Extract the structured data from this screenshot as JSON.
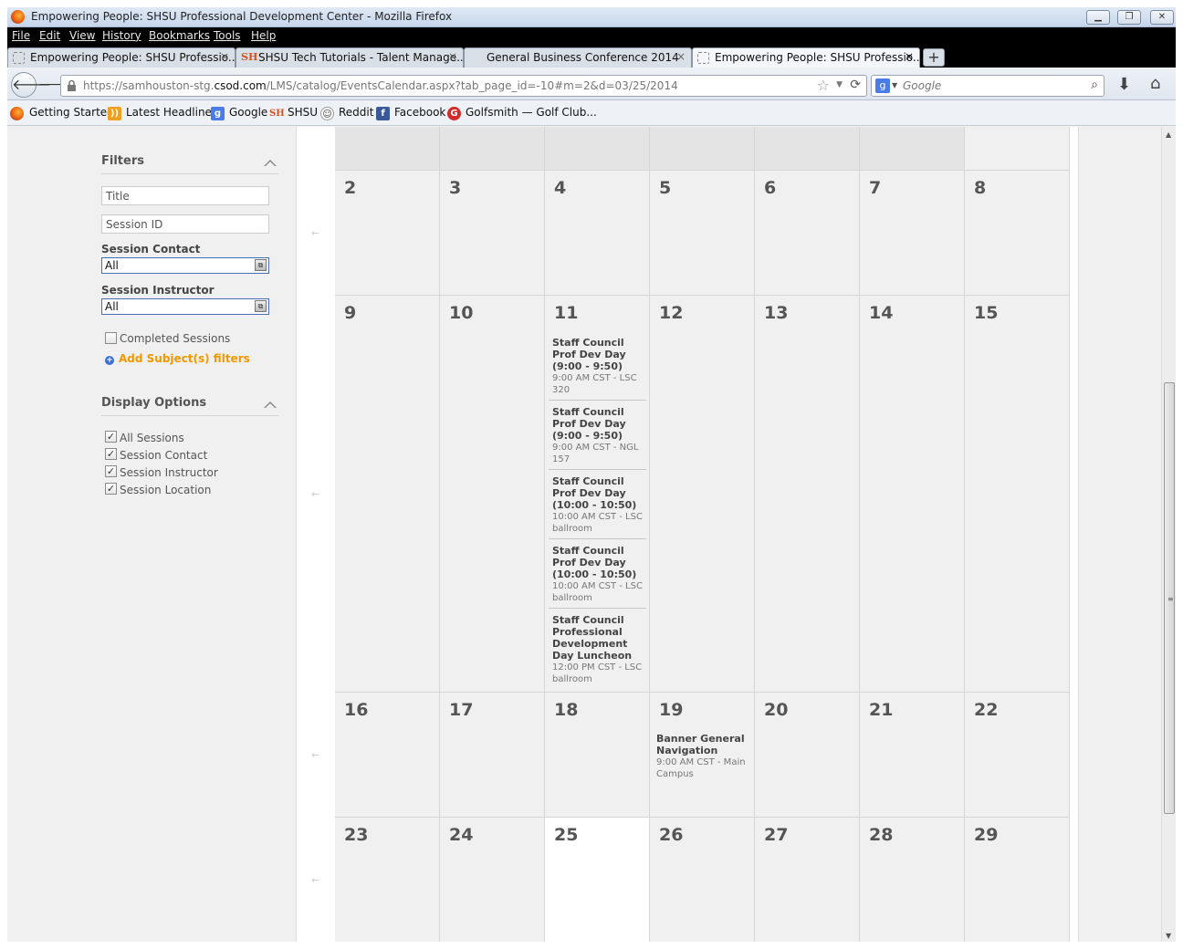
{
  "window": {
    "title": "Empowering People: SHSU Professional Development Center - Mozilla Firefox"
  },
  "menu": [
    "File",
    "Edit",
    "View",
    "History",
    "Bookmarks",
    "Tools",
    "Help"
  ],
  "tabs": [
    {
      "label": "Empowering People: SHSU Professio...",
      "icon": "blank-page-icon",
      "close": "×"
    },
    {
      "label": "SHSU Tech Tutorials - Talent Manage...",
      "icon": "shsu-icon",
      "close": "×"
    },
    {
      "label": "General Business Conference 2014",
      "icon": "none",
      "close": "×"
    },
    {
      "label": "Empowering People: SHSU Professio...",
      "icon": "blank-page-icon",
      "close": "×",
      "active": true
    }
  ],
  "newtab": "+",
  "nav": {
    "url_prefix": "https://samhouston-stg.",
    "url_domain": "csod.com",
    "url_suffix": "/LMS/catalog/EventsCalendar.aspx?tab_page_id=-10#m=2&d=03/25/2014",
    "search_placeholder": "Google",
    "search_engine_letter": "g"
  },
  "bookmarks": [
    {
      "label": "Getting Started",
      "icon": "firefox-icon",
      "color": "#e8540f"
    },
    {
      "label": "Latest Headlines",
      "icon": "rss-icon",
      "color": "#f0a020"
    },
    {
      "label": "Google",
      "icon": "google-icon",
      "color": "#4a7ce8",
      "glyph": "g"
    },
    {
      "label": "SHSU",
      "icon": "shsu-icon",
      "color": "#d0541f",
      "glyph": "SH"
    },
    {
      "label": "Reddit",
      "icon": "reddit-icon",
      "color": "#ffffff"
    },
    {
      "label": "Facebook",
      "icon": "facebook-icon",
      "color": "#3b5998",
      "glyph": "f"
    },
    {
      "label": "Golfsmith — Golf Club...",
      "icon": "golfsmith-icon",
      "color": "#d62828",
      "glyph": "G"
    }
  ],
  "filters": {
    "title": "Filters",
    "title_placeholder": "Title",
    "session_id_placeholder": "Session ID",
    "session_contact_label": "Session Contact",
    "session_contact_value": "All",
    "session_instructor_label": "Session Instructor",
    "session_instructor_value": "All",
    "completed_label": "Completed Sessions",
    "completed_checked": false,
    "add_subject_label": "Add Subject(s) filters"
  },
  "display_options": {
    "title": "Display Options",
    "items": [
      {
        "label": "All Sessions",
        "checked": true
      },
      {
        "label": "Session Contact",
        "checked": true
      },
      {
        "label": "Session Instructor",
        "checked": true
      },
      {
        "label": "Session Location",
        "checked": true
      }
    ]
  },
  "calendar": {
    "weeks": [
      {
        "days": [
          "2",
          "3",
          "4",
          "5",
          "6",
          "7",
          "8"
        ]
      },
      {
        "days": [
          "9",
          "10",
          "11",
          "12",
          "13",
          "14",
          "15"
        ]
      },
      {
        "days": [
          "16",
          "17",
          "18",
          "19",
          "20",
          "21",
          "22"
        ]
      },
      {
        "days": [
          "23",
          "24",
          "25",
          "26",
          "27",
          "28",
          "29"
        ]
      }
    ],
    "week_arrow": "←",
    "today": "25",
    "events_day_11": [
      {
        "title": "Staff Council Prof Dev Day (9:00 - 9:50)",
        "detail": "9:00 AM CST - LSC 320"
      },
      {
        "title": "Staff Council Prof Dev Day (9:00 - 9:50)",
        "detail": "9:00 AM CST - NGL 157"
      },
      {
        "title": "Staff Council Prof Dev Day (10:00 - 10:50)",
        "detail": "10:00 AM CST - LSC ballroom"
      },
      {
        "title": "Staff Council Prof Dev Day (10:00 - 10:50)",
        "detail": "10:00 AM CST - LSC ballroom"
      },
      {
        "title": "Staff Council Professional Development Day Luncheon",
        "detail": "12:00 PM CST - LSC ballroom"
      }
    ],
    "events_day_19": [
      {
        "title": "Banner General Navigation",
        "detail": "9:00 AM CST - Main Campus"
      }
    ]
  }
}
